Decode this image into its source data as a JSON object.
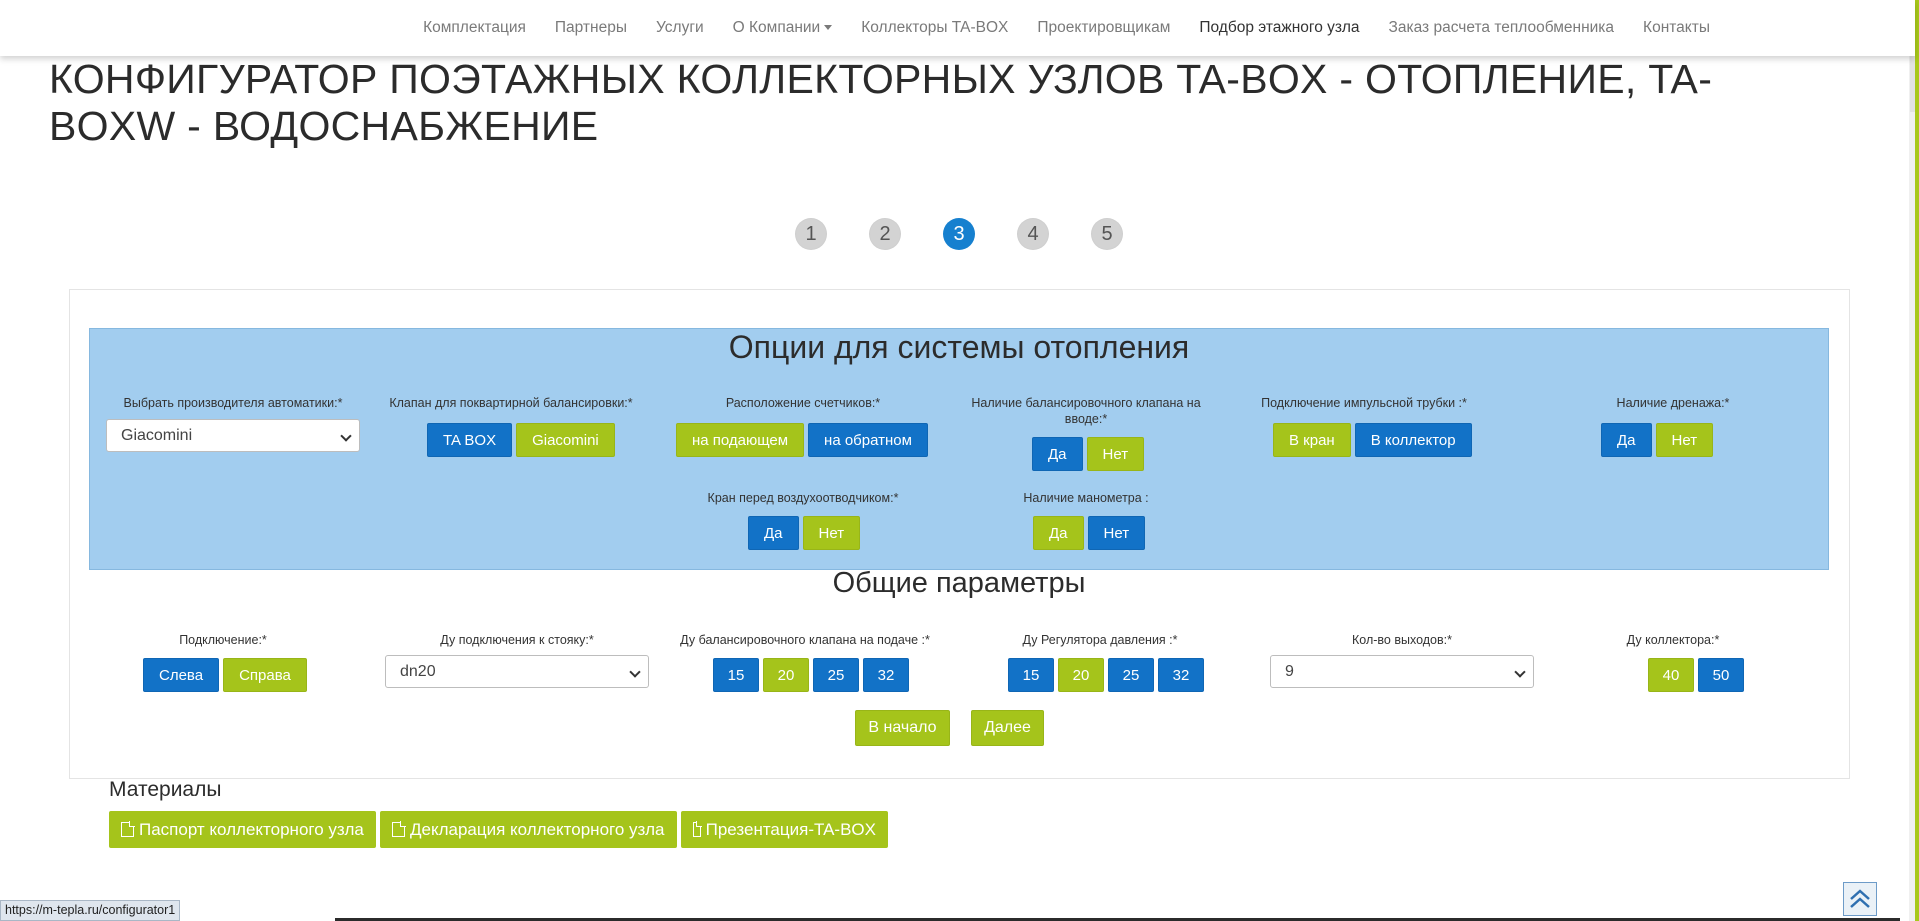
{
  "nav": {
    "items": [
      {
        "label": "Комплектация"
      },
      {
        "label": "Партнеры"
      },
      {
        "label": "Услуги"
      },
      {
        "label": "О Компании"
      },
      {
        "label": "Коллекторы TA-BOX"
      },
      {
        "label": "Проектировщикам"
      },
      {
        "label": "Подбор этажного узла"
      },
      {
        "label": "Заказ расчета теплообменника"
      },
      {
        "label": "Контакты"
      }
    ]
  },
  "page": {
    "title": "КОНФИГУРАТОР ПОЭТАЖНЫХ КОЛЛЕКТОРНЫХ УЗЛОВ TA-BOX - ОТОПЛЕНИЕ, TA-BOXW - ВОДОСНАБЖЕНИЕ"
  },
  "steps": [
    "1",
    "2",
    "3",
    "4",
    "5"
  ],
  "steps_active": "3",
  "heating": {
    "title": "Опции для системы отопления",
    "automation": {
      "label": "Выбрать производителя автоматики:*",
      "value": "Giacomini"
    },
    "balancing_valve": {
      "label": "Клапан для поквартирной балансировки:*",
      "options": [
        "TA BOX",
        "Giacomini"
      ]
    },
    "meter_location": {
      "label": "Расположение счетчиков:*",
      "options": [
        "на подающем",
        "на обратном"
      ]
    },
    "inlet_balancing": {
      "label": "Наличие балансировочного клапана на вводе:*",
      "options": [
        "Да",
        "Нет"
      ]
    },
    "impulse_tube": {
      "label": "Подключение импульсной трубки :*",
      "options": [
        "В кран",
        "В коллектор"
      ]
    },
    "drainage": {
      "label": "Наличие дренажа:*",
      "options": [
        "Да",
        "Нет"
      ]
    },
    "air_vent_valve": {
      "label": "Кран перед воздухоотводчиком:*",
      "options": [
        "Да",
        "Нет"
      ]
    },
    "manometer": {
      "label": "Наличие манометра :",
      "options": [
        "Да",
        "Нет"
      ]
    }
  },
  "general": {
    "title": "Общие параметры",
    "connection": {
      "label": "Подключение:*",
      "options": [
        "Слева",
        "Справа"
      ]
    },
    "riser_dn": {
      "label": "Ду подключения к стояку:*",
      "value": "dn20"
    },
    "supply_valve_dn": {
      "label": "Ду балансировочного клапана на подаче :*",
      "options": [
        "15",
        "20",
        "25",
        "32"
      ]
    },
    "regulator_dn": {
      "label": "Ду Регулятора давления :*",
      "options": [
        "15",
        "20",
        "25",
        "32"
      ]
    },
    "outlets": {
      "label": "Кол-во выходов:*",
      "value": "9"
    },
    "collector_dn": {
      "label": "Ду коллектора:*",
      "options": [
        "40",
        "50"
      ]
    },
    "back_label": "В начало",
    "next_label": "Далее"
  },
  "materials": {
    "title": "Материалы",
    "docs": [
      "Паспорт коллекторного узла",
      "Декларация коллекторного узла",
      "Презентация-TA-BOX"
    ]
  },
  "status": {
    "url": "https://m-tepla.ru/configurator1"
  },
  "colors": {
    "accent_blue": "#1272c7",
    "accent_green": "#a5c41b",
    "panel_blue": "#a2cdef"
  }
}
